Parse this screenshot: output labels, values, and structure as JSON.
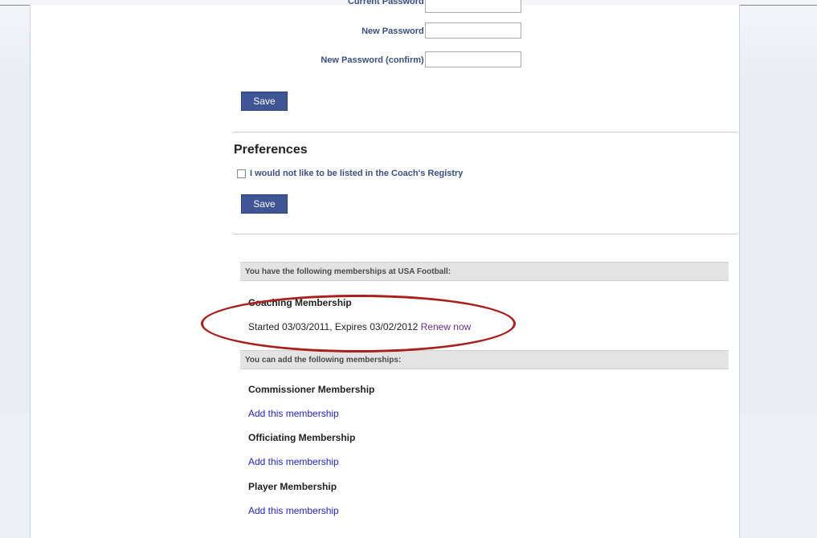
{
  "password": {
    "current_label": "Current Password",
    "new_label": "New Password",
    "confirm_label": "New Password (confirm)",
    "required_mark": "*",
    "save_label": "Save"
  },
  "preferences": {
    "heading": "Preferences",
    "checkbox_label": "I would not like to be listed in the Coach's Registry",
    "checked": false,
    "save_label": "Save"
  },
  "memberships": {
    "current_header": "You have the following memberships at USA Football:",
    "current": [
      {
        "name": "Coaching Membership",
        "detail": "Started 03/03/2011, Expires 03/02/2012",
        "action": "Renew now"
      }
    ],
    "available_header": "You can add the following memberships:",
    "available": [
      {
        "name": "Commissioner Membership",
        "action": "Add this membership"
      },
      {
        "name": "Officiating Membership",
        "action": "Add this membership"
      },
      {
        "name": "Player Membership",
        "action": "Add this membership"
      }
    ]
  },
  "colors": {
    "button": "#3f5596",
    "label": "#3a4f7f",
    "required": "#d42020",
    "link": "#2323c7",
    "annotation": "#a8201e"
  }
}
